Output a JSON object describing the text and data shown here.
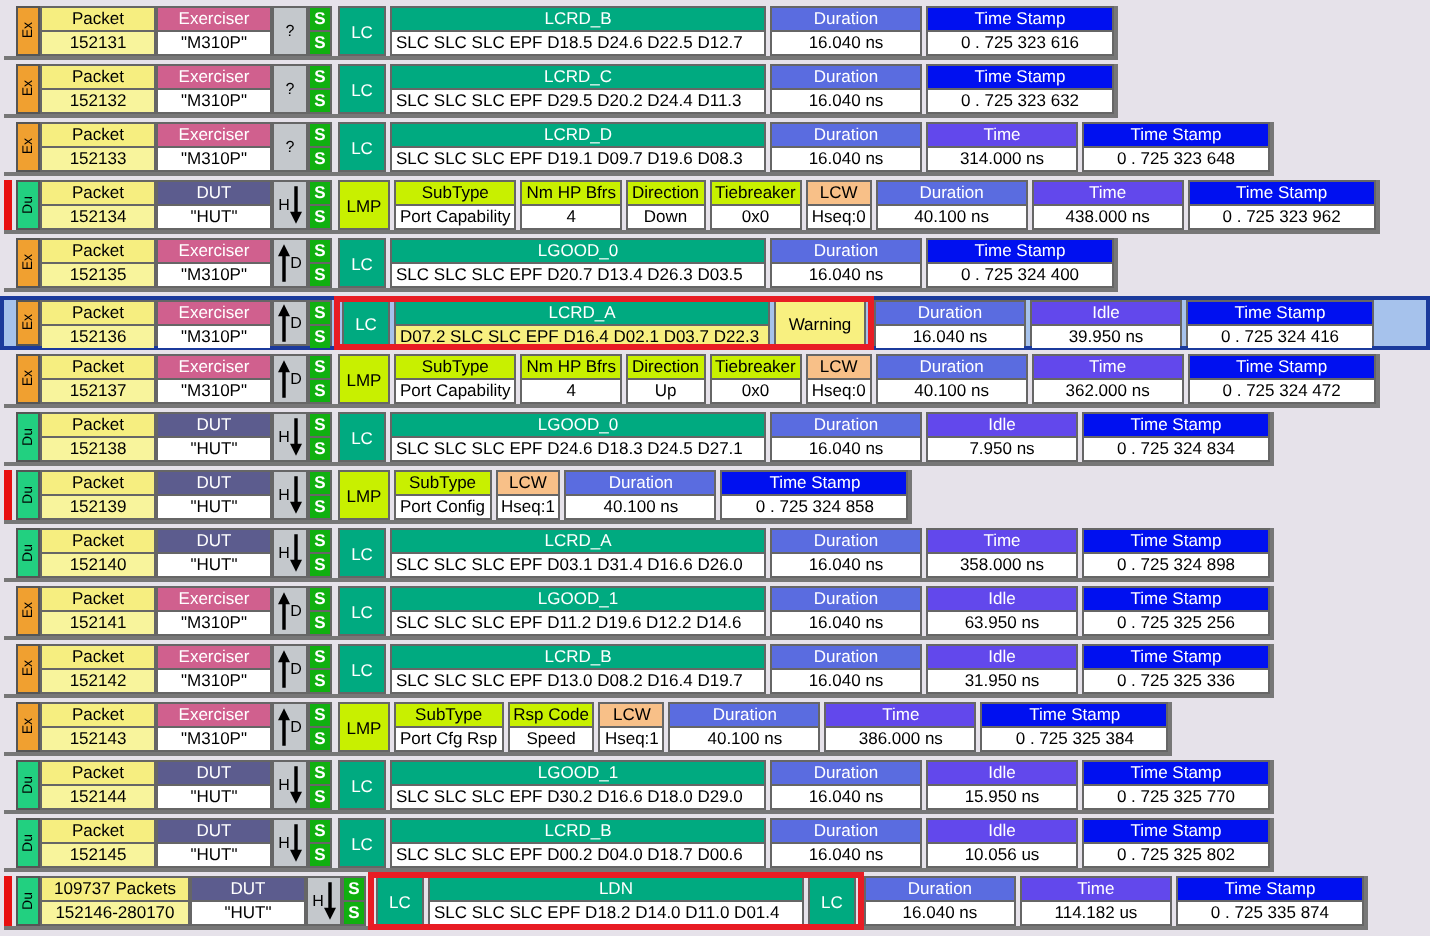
{
  "rows": [
    {
      "side": "Ex",
      "marker": false,
      "selected": false,
      "packet": {
        "label": "Packet",
        "value": "152131"
      },
      "source": {
        "kind": "exerciser",
        "label": "Exerciser",
        "value": "\"M310P\""
      },
      "dir": {
        "kind": "unknown",
        "label": "?"
      },
      "flags": [
        "S",
        "S"
      ],
      "fields": [
        {
          "kind": "lc",
          "text": "LC"
        },
        {
          "kind": "symbols",
          "header": "LCRD_B",
          "value": "SLC SLC SLC EPF D18.5 D24.6 D22.5 D12.7"
        },
        {
          "kind": "duration",
          "header": "Duration",
          "value": "16.040 ns"
        },
        {
          "kind": "timestamp",
          "header": "Time Stamp",
          "value": "0 . 725 323 616"
        }
      ]
    },
    {
      "side": "Ex",
      "marker": false,
      "selected": false,
      "packet": {
        "label": "Packet",
        "value": "152132"
      },
      "source": {
        "kind": "exerciser",
        "label": "Exerciser",
        "value": "\"M310P\""
      },
      "dir": {
        "kind": "unknown",
        "label": "?"
      },
      "flags": [
        "S",
        "S"
      ],
      "fields": [
        {
          "kind": "lc",
          "text": "LC"
        },
        {
          "kind": "symbols",
          "header": "LCRD_C",
          "value": "SLC SLC SLC EPF D29.5 D20.2 D24.4 D11.3"
        },
        {
          "kind": "duration",
          "header": "Duration",
          "value": "16.040 ns"
        },
        {
          "kind": "timestamp",
          "header": "Time Stamp",
          "value": "0 . 725 323 632"
        }
      ]
    },
    {
      "side": "Ex",
      "marker": false,
      "selected": false,
      "packet": {
        "label": "Packet",
        "value": "152133"
      },
      "source": {
        "kind": "exerciser",
        "label": "Exerciser",
        "value": "\"M310P\""
      },
      "dir": {
        "kind": "unknown",
        "label": "?"
      },
      "flags": [
        "S",
        "S"
      ],
      "fields": [
        {
          "kind": "lc",
          "text": "LC"
        },
        {
          "kind": "symbols",
          "header": "LCRD_D",
          "value": "SLC SLC SLC EPF D19.1 D09.7 D19.6 D08.3"
        },
        {
          "kind": "duration",
          "header": "Duration",
          "value": "16.040 ns"
        },
        {
          "kind": "time",
          "header": "Time",
          "value": "314.000 ns"
        },
        {
          "kind": "timestamp",
          "header": "Time Stamp",
          "value": "0 . 725 323 648"
        }
      ]
    },
    {
      "side": "Du",
      "marker": true,
      "selected": false,
      "packet": {
        "label": "Packet",
        "value": "152134"
      },
      "source": {
        "kind": "dut",
        "label": "DUT",
        "value": "\"HUT\""
      },
      "dir": {
        "kind": "down",
        "label": "H"
      },
      "flags": [
        "S",
        "S"
      ],
      "fields": [
        {
          "kind": "lmp",
          "text": "LMP"
        },
        {
          "kind": "sub",
          "header": "SubType",
          "value": "Port Capability"
        },
        {
          "kind": "sub",
          "header": "Nm HP Bfrs",
          "value": "4"
        },
        {
          "kind": "sub",
          "header": "Direction",
          "value": "Down"
        },
        {
          "kind": "sub",
          "header": "Tiebreaker",
          "value": "0x0"
        },
        {
          "kind": "lcw",
          "header": "LCW",
          "value": "Hseq:0"
        },
        {
          "kind": "duration",
          "header": "Duration",
          "value": "40.100 ns"
        },
        {
          "kind": "time",
          "header": "Time",
          "value": "438.000 ns"
        },
        {
          "kind": "timestamp",
          "header": "Time Stamp",
          "value": "0 . 725 323 962"
        }
      ]
    },
    {
      "side": "Ex",
      "marker": false,
      "selected": false,
      "packet": {
        "label": "Packet",
        "value": "152135"
      },
      "source": {
        "kind": "exerciser",
        "label": "Exerciser",
        "value": "\"M310P\""
      },
      "dir": {
        "kind": "up",
        "label": "D"
      },
      "flags": [
        "S",
        "S"
      ],
      "fields": [
        {
          "kind": "lc",
          "text": "LC"
        },
        {
          "kind": "symbols",
          "header": "LGOOD_0",
          "value": "SLC SLC SLC EPF D20.7 D13.4 D26.3 D03.5"
        },
        {
          "kind": "duration",
          "header": "Duration",
          "value": "16.040 ns"
        },
        {
          "kind": "timestamp",
          "header": "Time Stamp",
          "value": "0 . 725 324 400"
        }
      ]
    },
    {
      "side": "Ex",
      "marker": false,
      "selected": true,
      "packet": {
        "label": "Packet",
        "value": "152136"
      },
      "source": {
        "kind": "exerciser",
        "label": "Exerciser",
        "value": "\"M310P\""
      },
      "dir": {
        "kind": "up",
        "label": "D"
      },
      "flags": [
        "S",
        "S"
      ],
      "fields": [
        {
          "kind": "group",
          "flagged": true,
          "fields": [
            {
              "kind": "lc",
              "text": "LC"
            },
            {
              "kind": "symbols",
              "header": "LCRD_A",
              "value": "D07.2 SLC SLC EPF D16.4 D02.1 D03.7 D22.3",
              "error": true
            },
            {
              "kind": "warning",
              "text": "Warning"
            }
          ]
        },
        {
          "kind": "duration",
          "header": "Duration",
          "value": "16.040 ns"
        },
        {
          "kind": "idle",
          "header": "Idle",
          "value": "39.950 ns"
        },
        {
          "kind": "timestamp",
          "header": "Time Stamp",
          "value": "0 . 725 324 416"
        }
      ]
    },
    {
      "side": "Ex",
      "marker": false,
      "selected": false,
      "packet": {
        "label": "Packet",
        "value": "152137"
      },
      "source": {
        "kind": "exerciser",
        "label": "Exerciser",
        "value": "\"M310P\""
      },
      "dir": {
        "kind": "up",
        "label": "D"
      },
      "flags": [
        "S",
        "S"
      ],
      "fields": [
        {
          "kind": "lmp",
          "text": "LMP"
        },
        {
          "kind": "sub",
          "header": "SubType",
          "value": "Port Capability"
        },
        {
          "kind": "sub",
          "header": "Nm HP Bfrs",
          "value": "4"
        },
        {
          "kind": "sub",
          "header": "Direction",
          "value": "Up"
        },
        {
          "kind": "sub",
          "header": "Tiebreaker",
          "value": "0x0"
        },
        {
          "kind": "lcw",
          "header": "LCW",
          "value": "Hseq:0"
        },
        {
          "kind": "duration",
          "header": "Duration",
          "value": "40.100 ns"
        },
        {
          "kind": "time",
          "header": "Time",
          "value": "362.000 ns"
        },
        {
          "kind": "timestamp",
          "header": "Time Stamp",
          "value": "0 . 725 324 472"
        }
      ]
    },
    {
      "side": "Du",
      "marker": false,
      "selected": false,
      "packet": {
        "label": "Packet",
        "value": "152138"
      },
      "source": {
        "kind": "dut",
        "label": "DUT",
        "value": "\"HUT\""
      },
      "dir": {
        "kind": "down",
        "label": "H"
      },
      "flags": [
        "S",
        "S"
      ],
      "fields": [
        {
          "kind": "lc",
          "text": "LC"
        },
        {
          "kind": "symbols",
          "header": "LGOOD_0",
          "value": "SLC SLC SLC EPF D24.6 D18.3 D24.5 D27.1"
        },
        {
          "kind": "duration",
          "header": "Duration",
          "value": "16.040 ns"
        },
        {
          "kind": "idle",
          "header": "Idle",
          "value": "7.950 ns"
        },
        {
          "kind": "timestamp",
          "header": "Time Stamp",
          "value": "0 . 725 324 834"
        }
      ]
    },
    {
      "side": "Du",
      "marker": true,
      "selected": false,
      "packet": {
        "label": "Packet",
        "value": "152139"
      },
      "source": {
        "kind": "dut",
        "label": "DUT",
        "value": "\"HUT\""
      },
      "dir": {
        "kind": "down",
        "label": "H"
      },
      "flags": [
        "S",
        "S"
      ],
      "fields": [
        {
          "kind": "lmp",
          "text": "LMP"
        },
        {
          "kind": "sub",
          "header": "SubType",
          "value": "Port Config"
        },
        {
          "kind": "lcw",
          "header": "LCW",
          "value": "Hseq:1"
        },
        {
          "kind": "duration",
          "header": "Duration",
          "value": "40.100 ns"
        },
        {
          "kind": "timestamp",
          "header": "Time Stamp",
          "value": "0 . 725 324 858"
        }
      ]
    },
    {
      "side": "Du",
      "marker": false,
      "selected": false,
      "packet": {
        "label": "Packet",
        "value": "152140"
      },
      "source": {
        "kind": "dut",
        "label": "DUT",
        "value": "\"HUT\""
      },
      "dir": {
        "kind": "down",
        "label": "H"
      },
      "flags": [
        "S",
        "S"
      ],
      "fields": [
        {
          "kind": "lc",
          "text": "LC"
        },
        {
          "kind": "symbols",
          "header": "LCRD_A",
          "value": "SLC SLC SLC EPF D03.1 D31.4 D16.6 D26.0"
        },
        {
          "kind": "duration",
          "header": "Duration",
          "value": "16.040 ns"
        },
        {
          "kind": "time",
          "header": "Time",
          "value": "358.000 ns"
        },
        {
          "kind": "timestamp",
          "header": "Time Stamp",
          "value": "0 . 725 324 898"
        }
      ]
    },
    {
      "side": "Ex",
      "marker": false,
      "selected": false,
      "packet": {
        "label": "Packet",
        "value": "152141"
      },
      "source": {
        "kind": "exerciser",
        "label": "Exerciser",
        "value": "\"M310P\""
      },
      "dir": {
        "kind": "up",
        "label": "D"
      },
      "flags": [
        "S",
        "S"
      ],
      "fields": [
        {
          "kind": "lc",
          "text": "LC"
        },
        {
          "kind": "symbols",
          "header": "LGOOD_1",
          "value": "SLC SLC SLC EPF D11.2 D19.6 D12.2 D14.6"
        },
        {
          "kind": "duration",
          "header": "Duration",
          "value": "16.040 ns"
        },
        {
          "kind": "idle",
          "header": "Idle",
          "value": "63.950 ns"
        },
        {
          "kind": "timestamp",
          "header": "Time Stamp",
          "value": "0 . 725 325 256"
        }
      ]
    },
    {
      "side": "Ex",
      "marker": false,
      "selected": false,
      "packet": {
        "label": "Packet",
        "value": "152142"
      },
      "source": {
        "kind": "exerciser",
        "label": "Exerciser",
        "value": "\"M310P\""
      },
      "dir": {
        "kind": "up",
        "label": "D"
      },
      "flags": [
        "S",
        "S"
      ],
      "fields": [
        {
          "kind": "lc",
          "text": "LC"
        },
        {
          "kind": "symbols",
          "header": "LCRD_B",
          "value": "SLC SLC SLC EPF D13.0 D08.2 D16.4 D19.7"
        },
        {
          "kind": "duration",
          "header": "Duration",
          "value": "16.040 ns"
        },
        {
          "kind": "idle",
          "header": "Idle",
          "value": "31.950 ns"
        },
        {
          "kind": "timestamp",
          "header": "Time Stamp",
          "value": "0 . 725 325 336"
        }
      ]
    },
    {
      "side": "Ex",
      "marker": false,
      "selected": false,
      "packet": {
        "label": "Packet",
        "value": "152143"
      },
      "source": {
        "kind": "exerciser",
        "label": "Exerciser",
        "value": "\"M310P\""
      },
      "dir": {
        "kind": "up",
        "label": "D"
      },
      "flags": [
        "S",
        "S"
      ],
      "fields": [
        {
          "kind": "lmp",
          "text": "LMP"
        },
        {
          "kind": "sub",
          "header": "SubType",
          "value": "Port Cfg Rsp"
        },
        {
          "kind": "sub",
          "header": "Rsp Code",
          "value": "Speed"
        },
        {
          "kind": "lcw",
          "header": "LCW",
          "value": "Hseq:1"
        },
        {
          "kind": "duration",
          "header": "Duration",
          "value": "40.100 ns"
        },
        {
          "kind": "time",
          "header": "Time",
          "value": "386.000 ns"
        },
        {
          "kind": "timestamp",
          "header": "Time Stamp",
          "value": "0 . 725 325 384"
        }
      ]
    },
    {
      "side": "Du",
      "marker": false,
      "selected": false,
      "packet": {
        "label": "Packet",
        "value": "152144"
      },
      "source": {
        "kind": "dut",
        "label": "DUT",
        "value": "\"HUT\""
      },
      "dir": {
        "kind": "down",
        "label": "H"
      },
      "flags": [
        "S",
        "S"
      ],
      "fields": [
        {
          "kind": "lc",
          "text": "LC"
        },
        {
          "kind": "symbols",
          "header": "LGOOD_1",
          "value": "SLC SLC SLC EPF D30.2 D16.6 D18.0 D29.0"
        },
        {
          "kind": "duration",
          "header": "Duration",
          "value": "16.040 ns"
        },
        {
          "kind": "idle",
          "header": "Idle",
          "value": "15.950 ns"
        },
        {
          "kind": "timestamp",
          "header": "Time Stamp",
          "value": "0 . 725 325 770"
        }
      ]
    },
    {
      "side": "Du",
      "marker": false,
      "selected": false,
      "packet": {
        "label": "Packet",
        "value": "152145"
      },
      "source": {
        "kind": "dut",
        "label": "DUT",
        "value": "\"HUT\""
      },
      "dir": {
        "kind": "down",
        "label": "H"
      },
      "flags": [
        "S",
        "S"
      ],
      "fields": [
        {
          "kind": "lc",
          "text": "LC"
        },
        {
          "kind": "symbols",
          "header": "LCRD_B",
          "value": "SLC SLC SLC EPF D00.2 D04.0 D18.7 D00.6"
        },
        {
          "kind": "duration",
          "header": "Duration",
          "value": "16.040 ns"
        },
        {
          "kind": "idle",
          "header": "Idle",
          "value": "10.056 us"
        },
        {
          "kind": "timestamp",
          "header": "Time Stamp",
          "value": "0 . 725 325 802"
        }
      ]
    },
    {
      "side": "Du",
      "marker": true,
      "selected": false,
      "packet": {
        "label": "109737 Packets",
        "value": "152146-280170"
      },
      "source": {
        "kind": "dut",
        "label": "DUT",
        "value": "\"HUT\""
      },
      "dir": {
        "kind": "down",
        "label": "H"
      },
      "flags": [
        "S",
        "S"
      ],
      "fields": [
        {
          "kind": "group",
          "flagged": true,
          "fields": [
            {
              "kind": "lc",
              "text": "LC"
            },
            {
              "kind": "symbols",
              "header": "LDN",
              "value": "SLC SLC SLC EPF D18.2 D14.0 D11.0 D01.4"
            },
            {
              "kind": "lc",
              "text": "LC"
            }
          ]
        },
        {
          "kind": "duration",
          "header": "Duration",
          "value": "16.040 ns"
        },
        {
          "kind": "time",
          "header": "Time",
          "value": "114.182 us"
        },
        {
          "kind": "timestamp",
          "header": "Time Stamp",
          "value": "0 . 725 335 874"
        }
      ]
    }
  ]
}
